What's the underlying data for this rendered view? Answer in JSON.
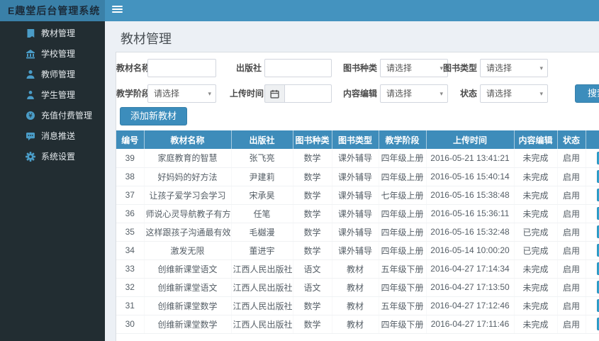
{
  "app": {
    "title": "E趣堂后台管理系统"
  },
  "colors": {
    "primary": "#3c8dbc",
    "topbar": "#4493bf",
    "logo_bg": "#3a80a8",
    "sidebar_bg": "#222d32",
    "sidebar_icon": "#4a9cc7",
    "table_header_bg": "#3e8cba",
    "content_bg": "#ecf0f5"
  },
  "sidebar": {
    "items": [
      {
        "label": "教材管理",
        "icon": "book-icon"
      },
      {
        "label": "学校管理",
        "icon": "school-icon"
      },
      {
        "label": "教师管理",
        "icon": "teacher-icon"
      },
      {
        "label": "学生管理",
        "icon": "student-icon"
      },
      {
        "label": "充值付费管理",
        "icon": "recharge-icon"
      },
      {
        "label": "消息推送",
        "icon": "message-icon"
      },
      {
        "label": "系统设置",
        "icon": "settings-icon"
      }
    ]
  },
  "page": {
    "title": "教材管理"
  },
  "filters": {
    "search_label": "搜索",
    "fields": [
      {
        "label": "教材名称",
        "type": "input",
        "value": ""
      },
      {
        "label": "出版社",
        "type": "input",
        "value": ""
      },
      {
        "label": "图书种类",
        "type": "select",
        "value": "请选择"
      },
      {
        "label": "图书类型",
        "type": "select",
        "value": "请选择"
      },
      {
        "label": "教学阶段",
        "type": "select",
        "value": "请选择"
      },
      {
        "label": "上传时间",
        "type": "date",
        "value": ""
      },
      {
        "label": "内容编辑",
        "type": "select",
        "value": "请选择"
      },
      {
        "label": "状态",
        "type": "select",
        "value": "请选择"
      }
    ]
  },
  "actions": {
    "add_label": "添加新教材"
  },
  "table": {
    "headers": [
      "编号",
      "教材名称",
      "出版社",
      "图书种类",
      "图书类型",
      "教学阶段",
      "上传时间",
      "内容编辑",
      "状态",
      ""
    ],
    "rows": [
      [
        "39",
        "家庭教育的智慧",
        "张飞亮",
        "数学",
        "课外辅导",
        "四年级上册",
        "2016-05-21 13:41:21",
        "未完成",
        "启用"
      ],
      [
        "38",
        "好妈妈的好方法",
        "尹建莉",
        "数学",
        "课外辅导",
        "四年级上册",
        "2016-05-16 15:40:14",
        "未完成",
        "启用"
      ],
      [
        "37",
        "让孩子爱学习会学习",
        "宋承昊",
        "数学",
        "课外辅导",
        "七年级上册",
        "2016-05-16 15:38:48",
        "未完成",
        "启用"
      ],
      [
        "36",
        "师说心灵导航教子有方",
        "任笔",
        "数学",
        "课外辅导",
        "四年级上册",
        "2016-05-16 15:36:11",
        "未完成",
        "启用"
      ],
      [
        "35",
        "这样跟孩子沟通最有效",
        "毛樾漫",
        "数学",
        "课外辅导",
        "四年级上册",
        "2016-05-16 15:32:48",
        "已完成",
        "启用"
      ],
      [
        "34",
        "激发无限",
        "董进宇",
        "数学",
        "课外辅导",
        "四年级上册",
        "2016-05-14 10:00:20",
        "已完成",
        "启用"
      ],
      [
        "33",
        "创维新课堂语文",
        "江西人民出版社",
        "语文",
        "教材",
        "五年级下册",
        "2016-04-27 17:14:34",
        "未完成",
        "启用"
      ],
      [
        "32",
        "创维新课堂语文",
        "江西人民出版社",
        "语文",
        "教材",
        "四年级下册",
        "2016-04-27 17:13:50",
        "未完成",
        "启用"
      ],
      [
        "31",
        "创维新课堂数学",
        "江西人民出版社",
        "数学",
        "教材",
        "五年级下册",
        "2016-04-27 17:12:46",
        "未完成",
        "启用"
      ],
      [
        "30",
        "创维新课堂数学",
        "江西人民出版社",
        "数学",
        "教材",
        "四年级下册",
        "2016-04-27 17:11:46",
        "未完成",
        "启用"
      ]
    ]
  }
}
